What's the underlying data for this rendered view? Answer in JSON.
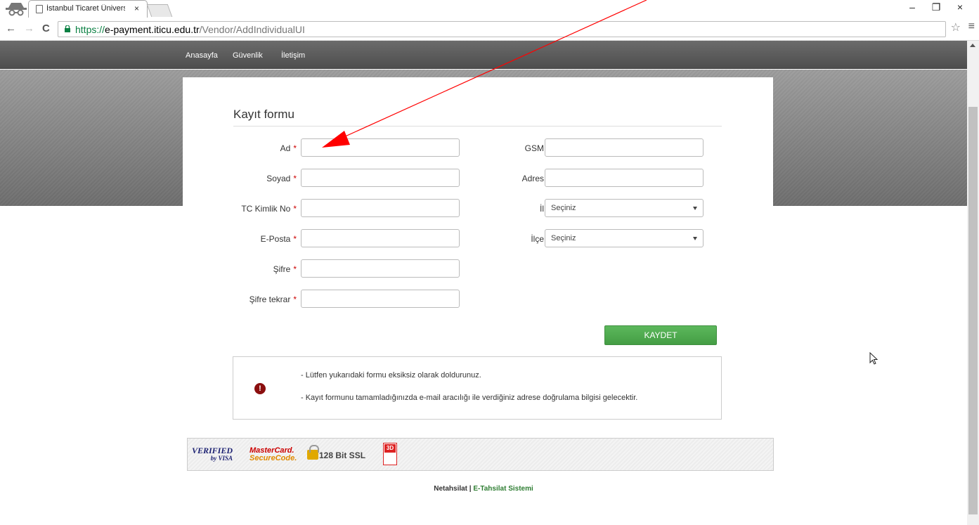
{
  "browser": {
    "tab_title": "İstanbul Ticaret Üniversite",
    "tab_close": "×",
    "url_scheme": "https://",
    "url_host": "e-payment.iticu.edu.tr",
    "url_path": "/Vendor/AddIndividualUI",
    "window_controls": [
      "–",
      "❐",
      "×"
    ]
  },
  "nav": {
    "items": [
      "Anasayfa",
      "Güvenlik",
      "İletişim"
    ]
  },
  "form": {
    "title": "Kayıt formu",
    "required_mark": "*",
    "left_fields": [
      {
        "label": "Ad",
        "value": ""
      },
      {
        "label": "Soyad",
        "value": ""
      },
      {
        "label": "TC Kimlik No",
        "value": ""
      },
      {
        "label": "E-Posta",
        "value": ""
      },
      {
        "label": "Şifre",
        "value": ""
      },
      {
        "label": "Şifre tekrar",
        "value": ""
      }
    ],
    "right_fields": [
      {
        "label": "GSM",
        "value": ""
      },
      {
        "label": "Adres",
        "value": ""
      }
    ],
    "selects": [
      {
        "label": "İl",
        "selected": "Seçiniz"
      },
      {
        "label": "İlçe",
        "selected": "Seçiniz"
      }
    ],
    "save_label": "KAYDET"
  },
  "notice": {
    "icon_text": "!",
    "lines": [
      "- Lütfen yukarıdaki formu eksiksiz olarak doldurunuz.",
      "- Kayıt formunu tamamladığınızda e-mail aracılığı ile verdiğiniz adrese doğrulama bilgisi gelecektir."
    ]
  },
  "badges": {
    "visa_top": "VERIFIED",
    "visa_bottom": "by VISA",
    "mc_top": "MasterCard.",
    "mc_bottom": "SecureCode.",
    "ssl": "128 Bit SSL",
    "tds": "3D"
  },
  "footer": {
    "prefix": "Netahsilat | ",
    "brand": "E-Tahsilat Sistemi"
  },
  "colors": {
    "save_button": "#4cae4c",
    "required": "#cc0000",
    "annotation_arrow": "#ff0000",
    "notice_icon": "#8b0f0f"
  }
}
